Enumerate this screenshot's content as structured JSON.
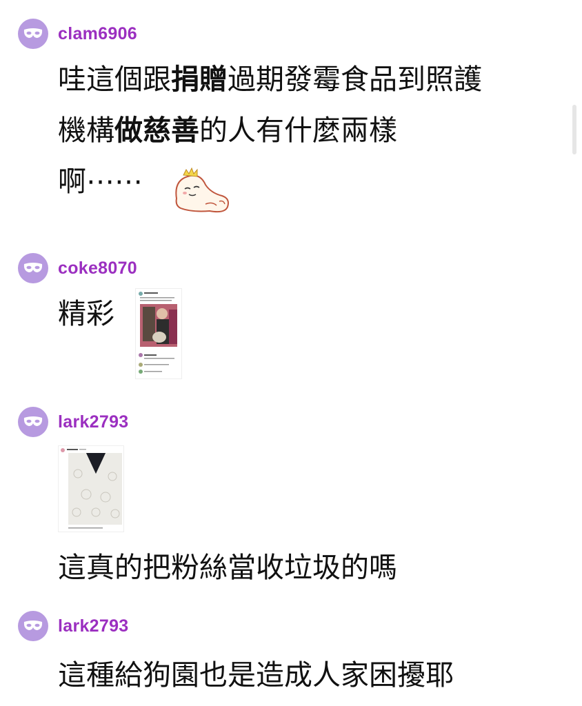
{
  "comments": [
    {
      "username": "clam6906",
      "lines": [
        {
          "pre": "哇這個跟",
          "bold": "捐贈",
          "post": "過期發霉食品到照護"
        },
        {
          "pre": "機構",
          "bold": "做慈善",
          "post": "的人有什麼兩樣"
        },
        {
          "pre": "啊⋯⋯",
          "bold": "",
          "post": ""
        }
      ],
      "sticker": "sleeping-blob-sticker"
    },
    {
      "username": "coke8070",
      "text": "精彩",
      "attachment": "chat-screenshot-photo"
    },
    {
      "username": "lark2793",
      "attachment": "lace-dress-photo",
      "text": "這真的把粉絲當收垃圾的嗎"
    },
    {
      "username": "lark2793",
      "text": "這種給狗園也是造成人家困擾耶"
    }
  ],
  "colors": {
    "avatar": "#b79ae0",
    "username": "#9b2fc0",
    "text": "#111111"
  }
}
